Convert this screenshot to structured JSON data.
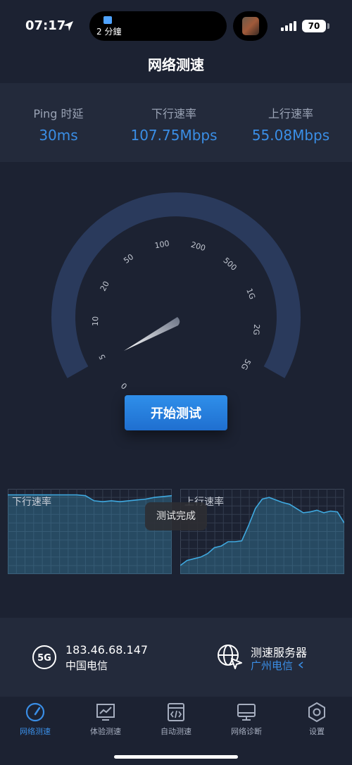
{
  "status_bar": {
    "time": "07:17",
    "island_text": "2 分鐘",
    "battery": "70"
  },
  "page": {
    "title": "网络测速"
  },
  "stats": [
    {
      "label": "Ping 时延",
      "value": "30ms"
    },
    {
      "label": "下行速率",
      "value": "107.75Mbps"
    },
    {
      "label": "上行速率",
      "value": "55.08Mbps"
    }
  ],
  "gauge": {
    "ticks": [
      "0",
      "5",
      "10",
      "20",
      "50",
      "100",
      "200",
      "500",
      "1G",
      "2G",
      "5G"
    ],
    "needle_value": "0"
  },
  "start_button": {
    "label": "开始测试"
  },
  "charts": {
    "download_label": "下行速率",
    "upload_label": "上行速率",
    "download_trend": [
      0.93,
      0.93,
      0.93,
      0.93,
      0.93,
      0.93,
      0.93,
      0.93,
      0.93,
      0.92,
      0.86,
      0.85,
      0.86,
      0.85,
      0.86,
      0.87,
      0.88,
      0.9,
      0.91,
      0.92
    ],
    "upload_trend": [
      0.1,
      0.16,
      0.18,
      0.2,
      0.24,
      0.31,
      0.33,
      0.38,
      0.38,
      0.39,
      0.57,
      0.77,
      0.88,
      0.9,
      0.87,
      0.84,
      0.82,
      0.77,
      0.72,
      0.73,
      0.75,
      0.72,
      0.74,
      0.73,
      0.6
    ]
  },
  "toast": {
    "text": "测试完成"
  },
  "network": {
    "ip": "183.46.68.147",
    "isp": "中国电信",
    "badge": "5G"
  },
  "server": {
    "title": "测速服务器",
    "name": "广州电信"
  },
  "colors": {
    "accent": "#3a8ee6",
    "background": "#1c2232",
    "panel": "#232a3b",
    "gauge_track": "#2a3a5c"
  },
  "tabs": [
    {
      "label": "网络测速",
      "icon": "speedometer-icon",
      "active": true
    },
    {
      "label": "体验测速",
      "icon": "chart-monitor-icon",
      "active": false
    },
    {
      "label": "自动测速",
      "icon": "code-window-icon",
      "active": false
    },
    {
      "label": "网络诊断",
      "icon": "monitor-icon",
      "active": false
    },
    {
      "label": "设置",
      "icon": "hexagon-settings-icon",
      "active": false
    }
  ]
}
